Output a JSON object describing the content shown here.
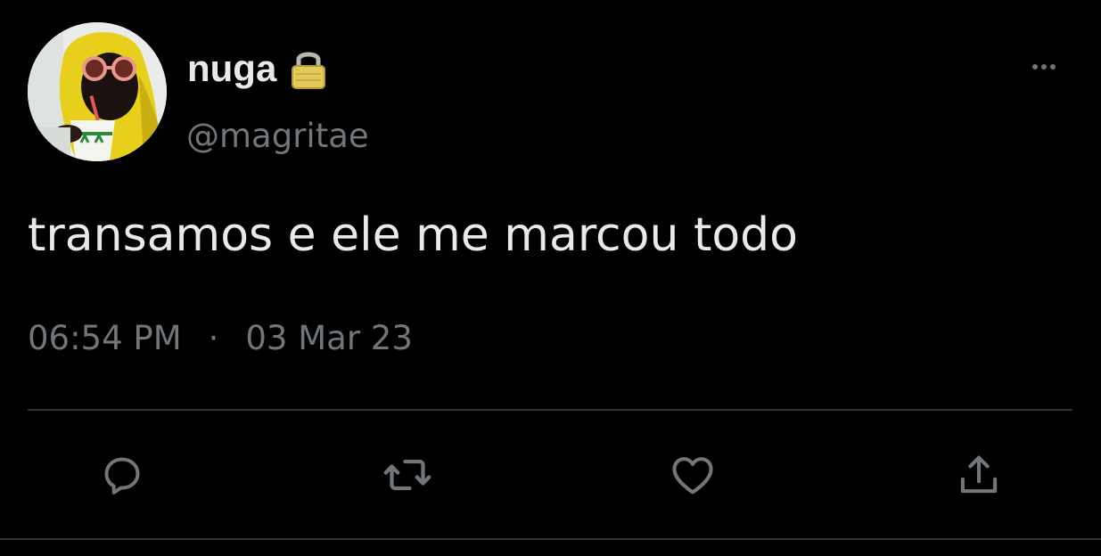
{
  "tweet": {
    "author": {
      "display_name": "nuga",
      "handle": "@magritae",
      "avatar": "profile-photo",
      "protected_icon": "lock-icon"
    },
    "text": "transamos e ele me marcou todo",
    "time": "06:54 PM",
    "separator": "·",
    "date": "03 Mar 23",
    "more_icon": "more-horizontal-icon"
  },
  "actions": [
    {
      "name": "reply",
      "icon": "reply-icon"
    },
    {
      "name": "retweet",
      "icon": "retweet-icon"
    },
    {
      "name": "like",
      "icon": "heart-icon"
    },
    {
      "name": "share",
      "icon": "share-icon"
    }
  ],
  "colors": {
    "background": "#000000",
    "primary_text": "#e7e9ea",
    "secondary_text": "#71767b",
    "divider": "#2f3336",
    "icon": "#71767b"
  }
}
